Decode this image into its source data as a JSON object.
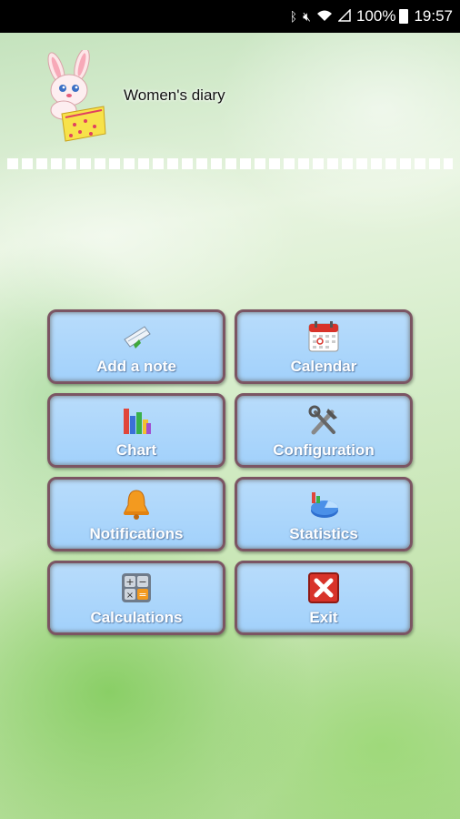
{
  "status_bar": {
    "battery": "100%",
    "time": "19:57"
  },
  "header": {
    "title": "Women's diary"
  },
  "menu": [
    {
      "label": "Add a note",
      "icon": "note-icon"
    },
    {
      "label": "Calendar",
      "icon": "calendar-icon"
    },
    {
      "label": "Chart",
      "icon": "bar-chart-icon"
    },
    {
      "label": "Configuration",
      "icon": "tools-icon"
    },
    {
      "label": "Notifications",
      "icon": "bell-icon"
    },
    {
      "label": "Statistics",
      "icon": "pie-chart-icon"
    },
    {
      "label": "Calculations",
      "icon": "calculator-icon"
    },
    {
      "label": "Exit",
      "icon": "close-icon"
    }
  ],
  "colors": {
    "button_fill": "#a8d4fb",
    "button_border": "#7b5563",
    "exit_red": "#d8332a"
  }
}
